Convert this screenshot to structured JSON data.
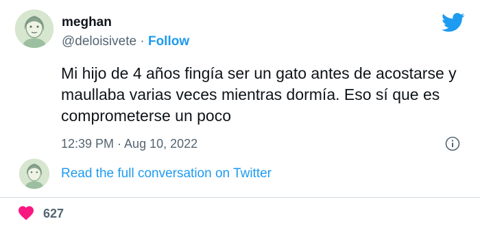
{
  "tweet": {
    "user": {
      "display_name": "meghan",
      "handle": "@deloisivete",
      "separator": " · ",
      "follow_label": "Follow"
    },
    "text": "Mi hijo de 4 años fingía ser un gato antes de acostarse y maullaba varias veces mientras dormía. Eso sí que es comprometerse un poco",
    "timestamp": "12:39 PM · Aug 10, 2022",
    "read_conversation_label": "Read the full conversation on Twitter",
    "likes": "627"
  },
  "colors": {
    "accent": "#1d9bf0",
    "heart": "#f91880",
    "secondary_text": "#536471",
    "primary_text": "#0f1419"
  },
  "icons": [
    "twitter-bird-icon",
    "info-icon",
    "heart-icon"
  ]
}
